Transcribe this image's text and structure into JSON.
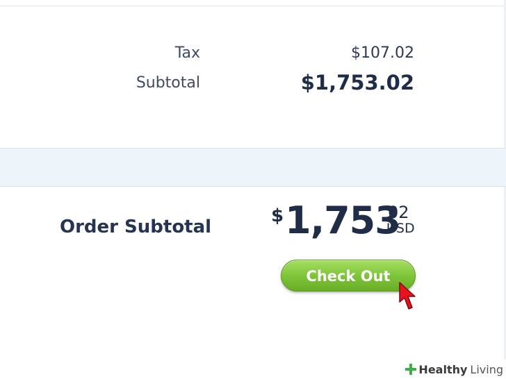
{
  "summary": {
    "tax_label": "Tax",
    "tax_value": "$107.02",
    "subtotal_label": "Subtotal",
    "subtotal_value": "$1,753.02"
  },
  "order": {
    "label": "Order Subtotal",
    "currency_symbol": "$",
    "amount_main": "1,753",
    "amount_cents": "02",
    "currency_code": "USD"
  },
  "actions": {
    "checkout_label": "Check Out"
  },
  "watermark": {
    "brand_strong": "Healthy",
    "brand_light": "Living"
  },
  "colors": {
    "text_dark": "#1f2d46",
    "band": "#edf5fb",
    "button_green": "#7fc53a",
    "cursor_red": "#e8121f",
    "logo_green": "#3fae49"
  },
  "icons": {
    "cursor": "mouse-pointer-icon",
    "logo": "plus-cross-icon"
  }
}
